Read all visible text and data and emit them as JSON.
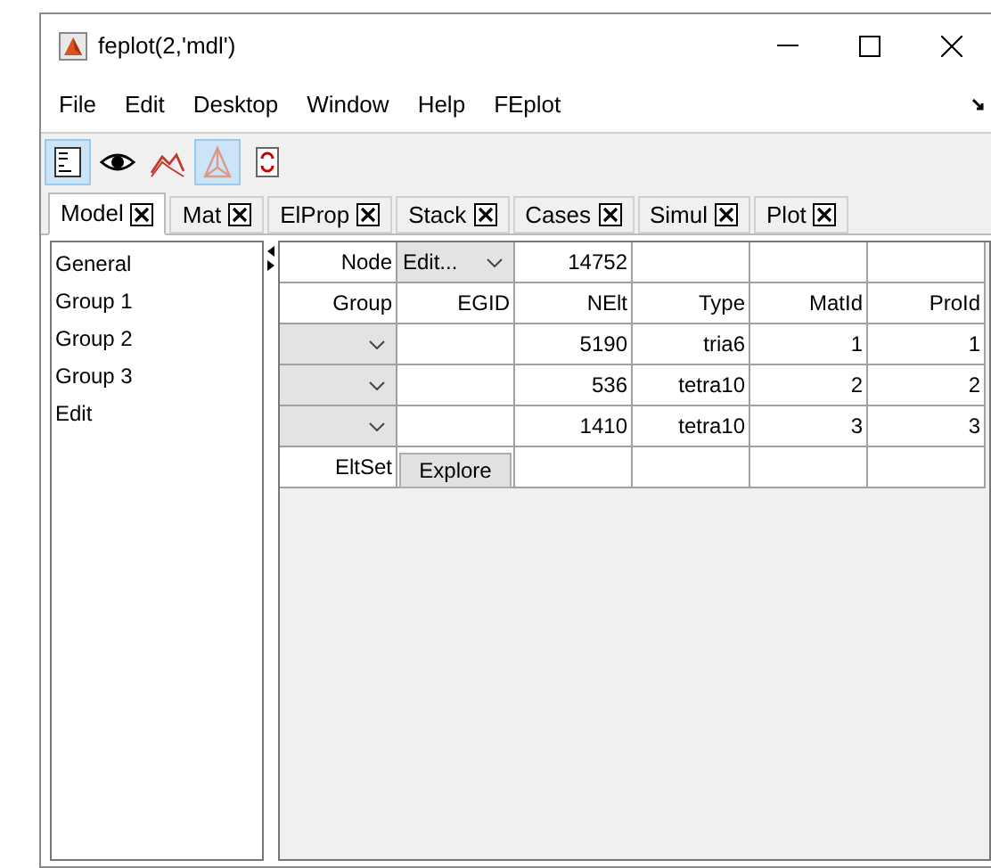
{
  "window": {
    "title": "feplot(2,'mdl')"
  },
  "menu": [
    "File",
    "Edit",
    "Desktop",
    "Window",
    "Help",
    "FEplot"
  ],
  "toolbar": [
    {
      "kind": "list",
      "selected": true
    },
    {
      "kind": "eye",
      "selected": false
    },
    {
      "kind": "curve",
      "selected": false
    },
    {
      "kind": "mesh",
      "selected": true
    },
    {
      "kind": "refresh",
      "selected": false
    }
  ],
  "tabs": [
    {
      "label": "Model",
      "selected": true
    },
    {
      "label": "Mat",
      "selected": false
    },
    {
      "label": "ElProp",
      "selected": false
    },
    {
      "label": "Stack",
      "selected": false
    },
    {
      "label": "Cases",
      "selected": false
    },
    {
      "label": "Simul",
      "selected": false
    },
    {
      "label": "Plot",
      "selected": false
    }
  ],
  "sidebar": {
    "items": [
      "General",
      "Group 1",
      "Group 2",
      "Group 3",
      "Edit"
    ]
  },
  "table": {
    "rows": [
      [
        {
          "kind": "label",
          "text": "Node"
        },
        {
          "kind": "dropdown",
          "text": "Edit..."
        },
        {
          "kind": "text",
          "text": "14752"
        },
        {
          "kind": "empty"
        },
        {
          "kind": "empty"
        },
        {
          "kind": "empty"
        }
      ],
      [
        {
          "kind": "label",
          "text": "Group"
        },
        {
          "kind": "text",
          "text": "EGID"
        },
        {
          "kind": "text",
          "text": "NElt"
        },
        {
          "kind": "text",
          "text": "Type"
        },
        {
          "kind": "text",
          "text": "MatId"
        },
        {
          "kind": "text",
          "text": "ProId"
        }
      ],
      [
        {
          "kind": "dropdown"
        },
        {
          "kind": "empty"
        },
        {
          "kind": "text",
          "text": "5190"
        },
        {
          "kind": "text",
          "text": "tria6"
        },
        {
          "kind": "text",
          "text": "1"
        },
        {
          "kind": "text",
          "text": "1"
        }
      ],
      [
        {
          "kind": "dropdown"
        },
        {
          "kind": "empty"
        },
        {
          "kind": "text",
          "text": "536"
        },
        {
          "kind": "text",
          "text": "tetra10"
        },
        {
          "kind": "text",
          "text": "2"
        },
        {
          "kind": "text",
          "text": "2"
        }
      ],
      [
        {
          "kind": "dropdown"
        },
        {
          "kind": "empty"
        },
        {
          "kind": "text",
          "text": "1410"
        },
        {
          "kind": "text",
          "text": "tetra10"
        },
        {
          "kind": "text",
          "text": "3"
        },
        {
          "kind": "text",
          "text": "3"
        }
      ],
      [
        {
          "kind": "label",
          "text": "EltSet"
        },
        {
          "kind": "button",
          "text": "Explore"
        },
        {
          "kind": "empty"
        },
        {
          "kind": "empty"
        },
        {
          "kind": "empty"
        },
        {
          "kind": "empty"
        }
      ]
    ]
  }
}
